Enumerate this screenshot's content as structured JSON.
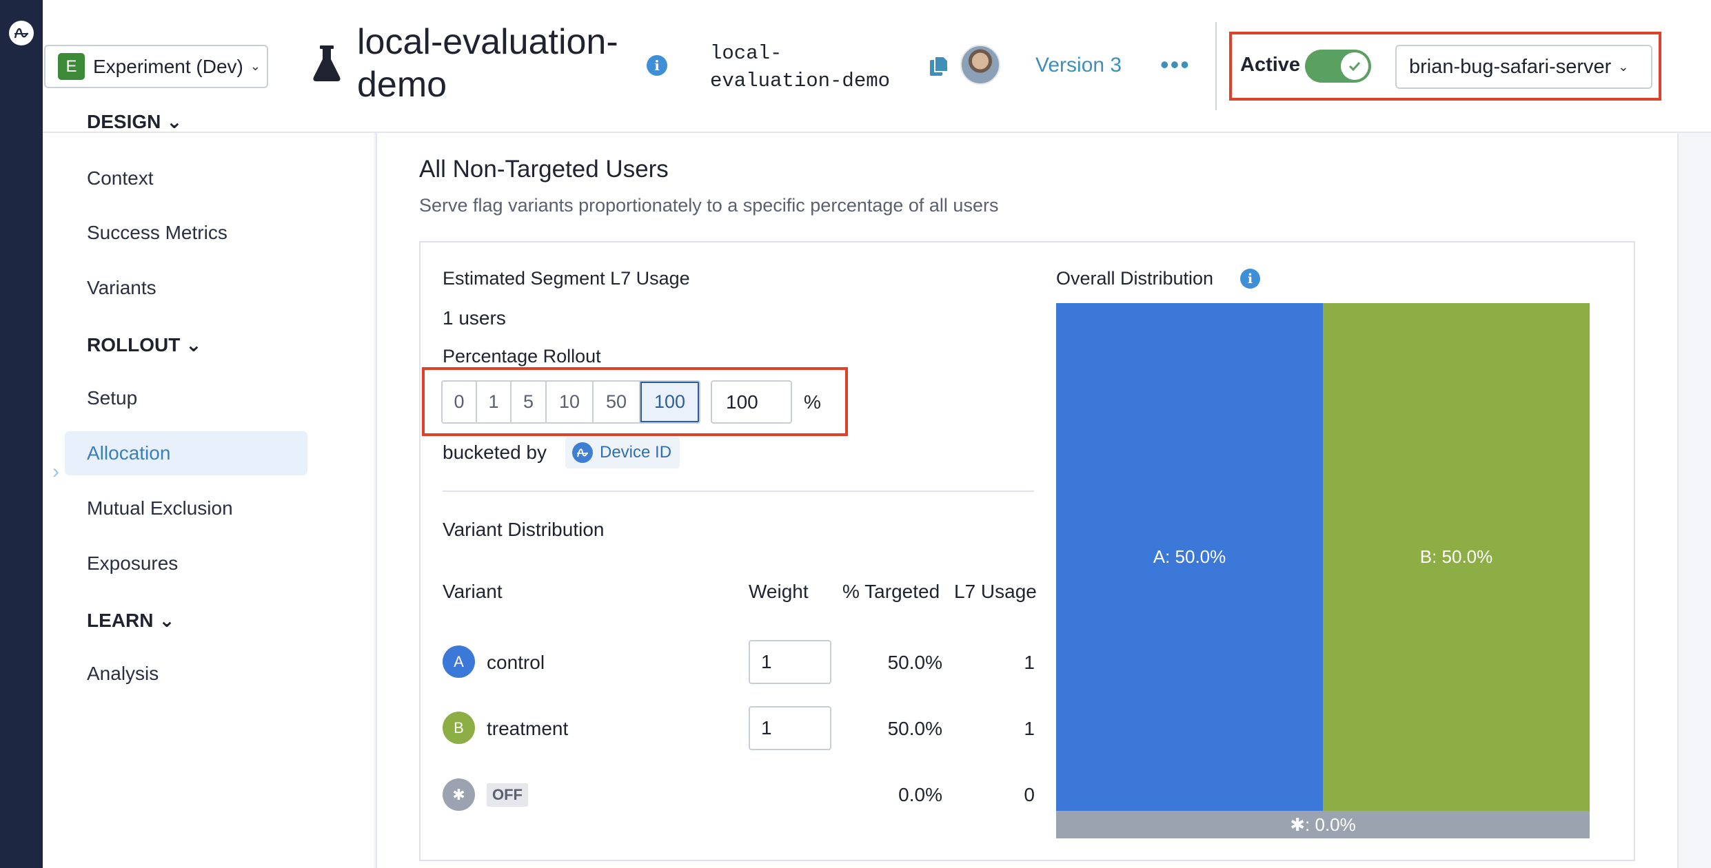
{
  "header": {
    "project": {
      "badge": "E",
      "label": "Experiment (Dev)"
    },
    "flag_title": "local-evaluation-demo",
    "flag_key_line1": "local-",
    "flag_key_line2": "evaluation-demo",
    "version": "Version 3",
    "active_label": "Active",
    "active": true,
    "environment": "brian-bug-safari-server"
  },
  "sidebar": {
    "sections": [
      {
        "title": "DESIGN",
        "items": [
          "Context",
          "Success Metrics",
          "Variants"
        ]
      },
      {
        "title": "ROLLOUT",
        "items": [
          "Setup",
          "Allocation",
          "Mutual Exclusion",
          "Exposures"
        ]
      },
      {
        "title": "LEARN",
        "items": [
          "Analysis"
        ]
      }
    ],
    "selected": "Allocation"
  },
  "main": {
    "section_title": "All Non-Targeted Users",
    "section_desc": "Serve flag variants proportionately to a specific percentage of all users",
    "segment_usage_label": "Estimated Segment L7 Usage",
    "segment_usage_value": "1 users",
    "rollout_label": "Percentage Rollout",
    "rollout_options": [
      "0",
      "1",
      "5",
      "10",
      "50",
      "100"
    ],
    "rollout_selected": "100",
    "rollout_value": "100",
    "rollout_unit": "%",
    "bucketed_by_label": "bucketed by",
    "bucketed_by_value": "Device ID",
    "variant_distribution_label": "Variant Distribution",
    "columns": {
      "variant": "Variant",
      "weight": "Weight",
      "targeted": "% Targeted",
      "usage": "L7 Usage"
    },
    "variants": [
      {
        "letter": "A",
        "name": "control",
        "weight": "1",
        "targeted": "50.0%",
        "usage": "1",
        "color": "#3b78d8"
      },
      {
        "letter": "B",
        "name": "treatment",
        "weight": "1",
        "targeted": "50.0%",
        "usage": "1",
        "color": "#8dae45"
      },
      {
        "letter": "✱",
        "name": "OFF",
        "weight": "",
        "targeted": "0.0%",
        "usage": "0",
        "color": "#9ba3b0"
      }
    ]
  },
  "distribution": {
    "title": "Overall Distribution",
    "segments": [
      {
        "label": "A: 50.0%",
        "share": 50.0,
        "color": "#3b78d8"
      },
      {
        "label": "B: 50.0%",
        "share": 50.0,
        "color": "#8dae45"
      },
      {
        "label": "✱: 0.0%",
        "share": 0.0,
        "color": "#9ba3b0"
      }
    ]
  }
}
